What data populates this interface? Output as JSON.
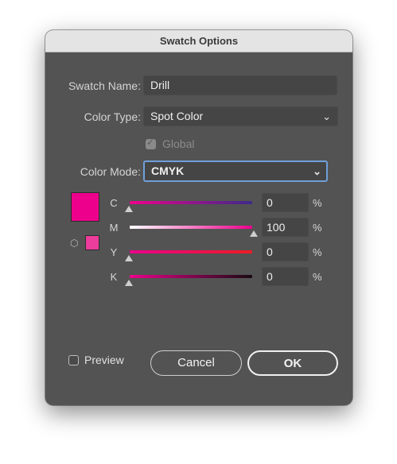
{
  "window": {
    "title": "Swatch Options"
  },
  "swatch_name": {
    "label": "Swatch Name:",
    "value": "Drill"
  },
  "color_type": {
    "label": "Color Type:",
    "value": "Spot Color"
  },
  "global": {
    "label": "Global",
    "checked": true,
    "disabled": true
  },
  "color_mode": {
    "label": "Color Mode:",
    "value": "CMYK"
  },
  "colors": {
    "swatch": "#ec008c",
    "out_of_gamut": "#ec3c9c"
  },
  "sliders": [
    {
      "channel": "C",
      "value": "0",
      "unit": "%"
    },
    {
      "channel": "M",
      "value": "100",
      "unit": "%"
    },
    {
      "channel": "Y",
      "value": "0",
      "unit": "%"
    },
    {
      "channel": "K",
      "value": "0",
      "unit": "%"
    }
  ],
  "preview": {
    "label": "Preview",
    "checked": false
  },
  "buttons": {
    "cancel": "Cancel",
    "ok": "OK"
  }
}
